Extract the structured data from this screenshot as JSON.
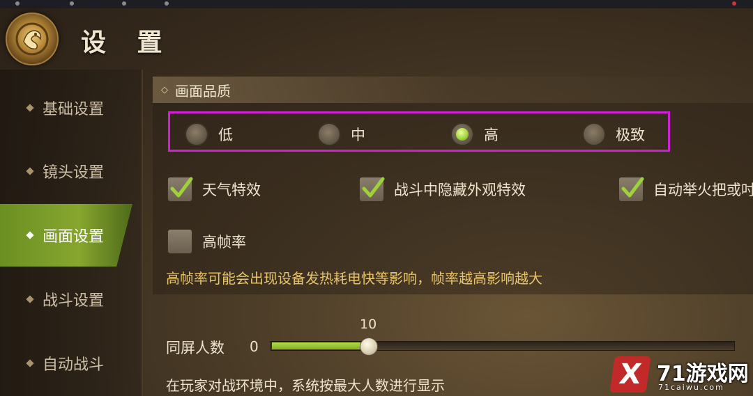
{
  "header": {
    "title": "设 置"
  },
  "sidebar": {
    "items": [
      {
        "label": "基础设置",
        "active": false
      },
      {
        "label": "镜头设置",
        "active": false
      },
      {
        "label": "画面设置",
        "active": true
      },
      {
        "label": "战斗设置",
        "active": false
      },
      {
        "label": "自动战斗",
        "active": false
      }
    ]
  },
  "section": {
    "title": "画面品质",
    "quality_options": [
      {
        "label": "低",
        "selected": false
      },
      {
        "label": "中",
        "selected": false
      },
      {
        "label": "高",
        "selected": true
      },
      {
        "label": "极致",
        "selected": false
      }
    ],
    "checkboxes": [
      {
        "label": "天气特效",
        "checked": true
      },
      {
        "label": "战斗中隐藏外观特效",
        "checked": true
      },
      {
        "label": "自动举火把或吋",
        "checked": true
      },
      {
        "label": "高帧率",
        "checked": false
      }
    ],
    "warning": "高帧率可能会出现设备发热耗电快等影响，帧率越高影响越大"
  },
  "slider": {
    "label": "同屏人数",
    "min_label": "0",
    "value_label": "10",
    "fill_fraction": 0.21,
    "description": "在玩家对战环境中，系统按最大人数进行显示"
  },
  "watermark": {
    "logo_glyph": "X",
    "brand": "71游戏网",
    "sub": "71caiwu.com"
  },
  "colors": {
    "accent_green": "#86a62e",
    "highlight_border": "#d21ed6",
    "warning_text": "#e8c36a"
  }
}
